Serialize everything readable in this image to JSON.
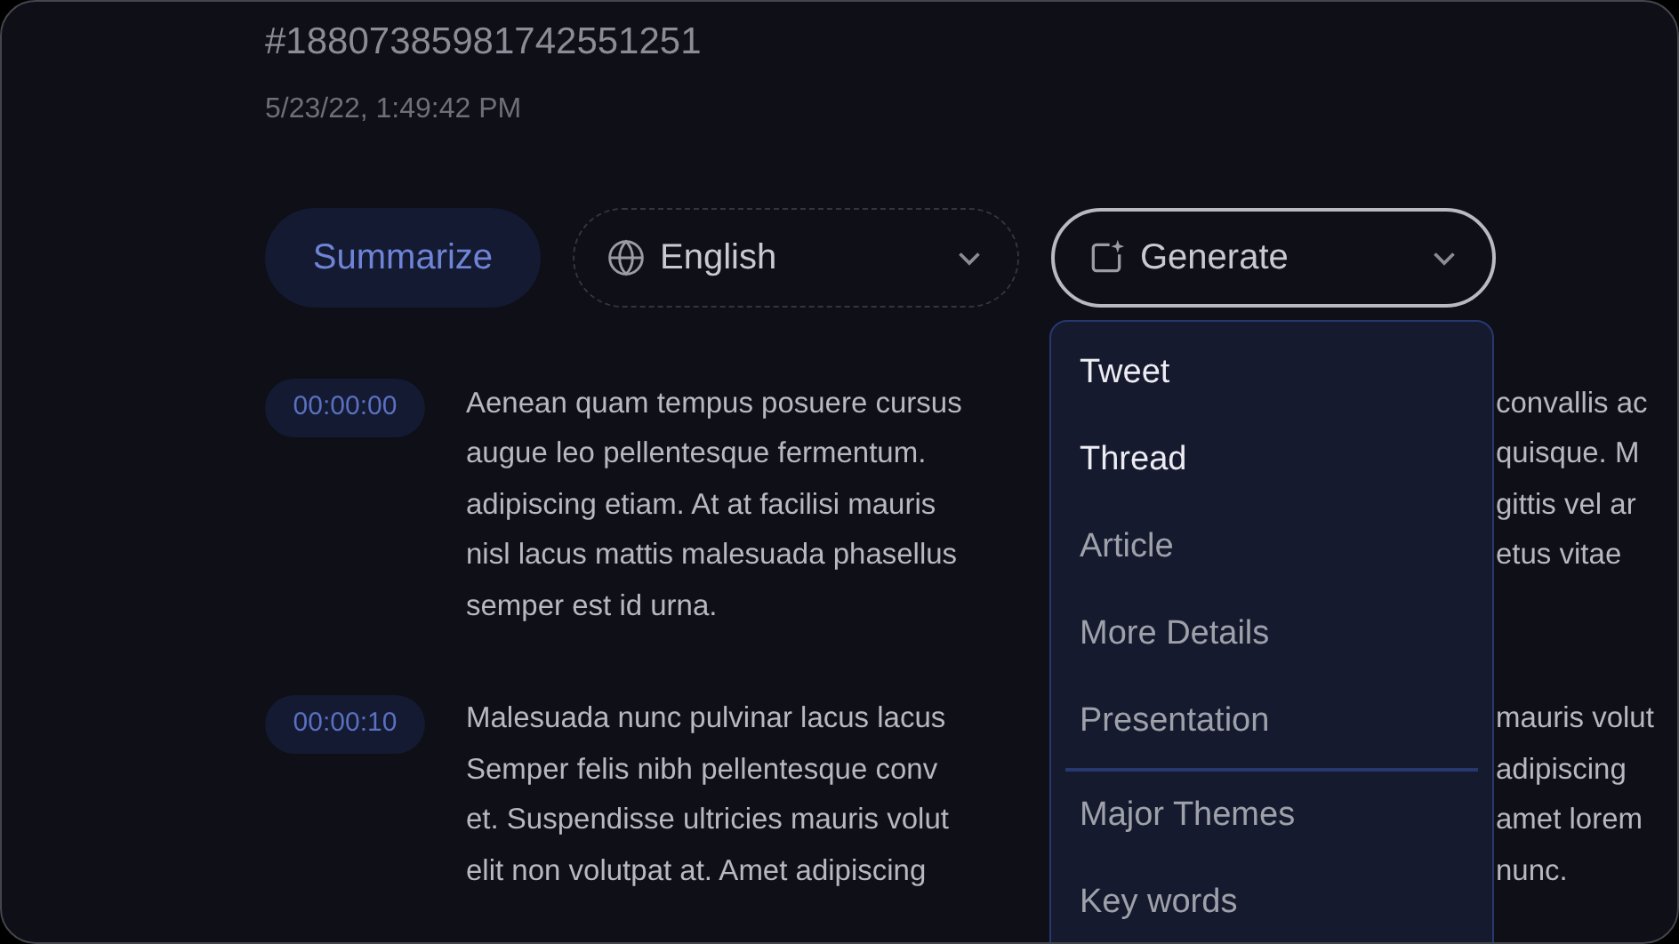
{
  "record": {
    "id": "#18807385981742551251",
    "timestamp": "5/23/22, 1:49:42 PM"
  },
  "toolbar": {
    "summarize": "Summarize",
    "language": "English",
    "generate": "Generate"
  },
  "generate_menu": {
    "sections": [
      {
        "items": [
          {
            "label": "Tweet",
            "highlighted": true
          },
          {
            "label": "Thread",
            "highlighted": true
          },
          {
            "label": "Article",
            "highlighted": false
          },
          {
            "label": "More Details",
            "highlighted": false
          },
          {
            "label": "Presentation",
            "highlighted": false
          }
        ]
      },
      {
        "items": [
          {
            "label": "Major Themes",
            "highlighted": false
          },
          {
            "label": "Key words",
            "highlighted": false
          }
        ]
      }
    ]
  },
  "transcript": [
    {
      "time": "00:00:00",
      "lines": [
        {
          "left": "Aenean quam tempus posuere cursus",
          "right": "convallis ac"
        },
        {
          "left": "augue leo pellentesque fermentum.",
          "right": "quisque. M"
        },
        {
          "left": "adipiscing etiam. At at facilisi mauris",
          "right": "gittis vel ar"
        },
        {
          "left": "nisl lacus mattis malesuada phasellus",
          "right": "etus vitae"
        },
        {
          "left": "semper est id urna."
        }
      ]
    },
    {
      "time": "00:00:10",
      "lines": [
        {
          "left": "Malesuada nunc pulvinar lacus lacus",
          "right": "mauris volut"
        },
        {
          "left": "Semper felis nibh pellentesque conv",
          "right": "adipiscing"
        },
        {
          "left": "et. Suspendisse ultricies mauris volut",
          "right": "amet lorem"
        },
        {
          "left": "elit non volutpat at. Amet adipiscing",
          "right": "nunc."
        }
      ]
    }
  ]
}
